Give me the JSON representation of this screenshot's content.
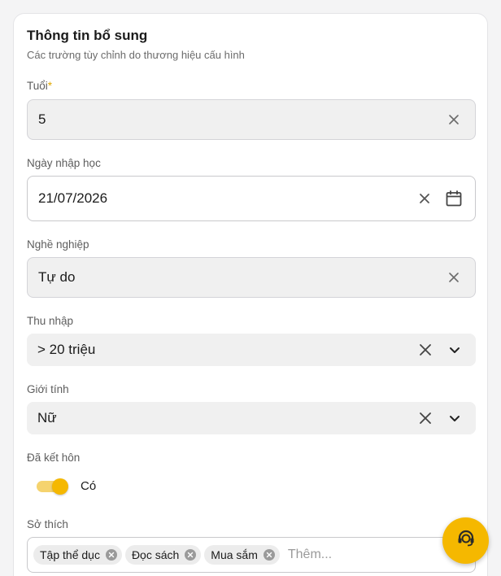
{
  "section": {
    "title": "Thông tin bổ sung",
    "subtitle": "Các trường tùy chỉnh do thương hiệu cấu hình"
  },
  "fields": {
    "age": {
      "label": "Tuổi",
      "required_mark": "*",
      "value": "5",
      "clear_icon": "close-icon"
    },
    "enroll_date": {
      "label": "Ngày nhập học",
      "value": "21/07/2026",
      "clear_icon": "close-icon",
      "picker_icon": "calendar-icon"
    },
    "occupation": {
      "label": "Nghề nghiệp",
      "value": "Tự do",
      "clear_icon": "close-icon"
    },
    "income": {
      "label": "Thu nhập",
      "value": "> 20 triệu",
      "clear_icon": "close-icon",
      "dropdown_icon": "chevron-down-icon"
    },
    "gender": {
      "label": "Giới tính",
      "value": "Nữ",
      "clear_icon": "close-icon",
      "dropdown_icon": "chevron-down-icon"
    },
    "married": {
      "label": "Đã kết hôn",
      "toggle_on": true,
      "toggle_text": "Có"
    },
    "hobbies": {
      "label": "Sở thích",
      "tags": [
        "Tập thể dục",
        "Đọc sách",
        "Mua sắm"
      ],
      "placeholder": "Thêm..."
    }
  },
  "fab": {
    "icon": "support-agent-icon"
  },
  "colors": {
    "accent": "#f5b800",
    "accent_light": "#f5d36e",
    "required": "#e0a800",
    "field_bg": "#f0f0f0"
  }
}
